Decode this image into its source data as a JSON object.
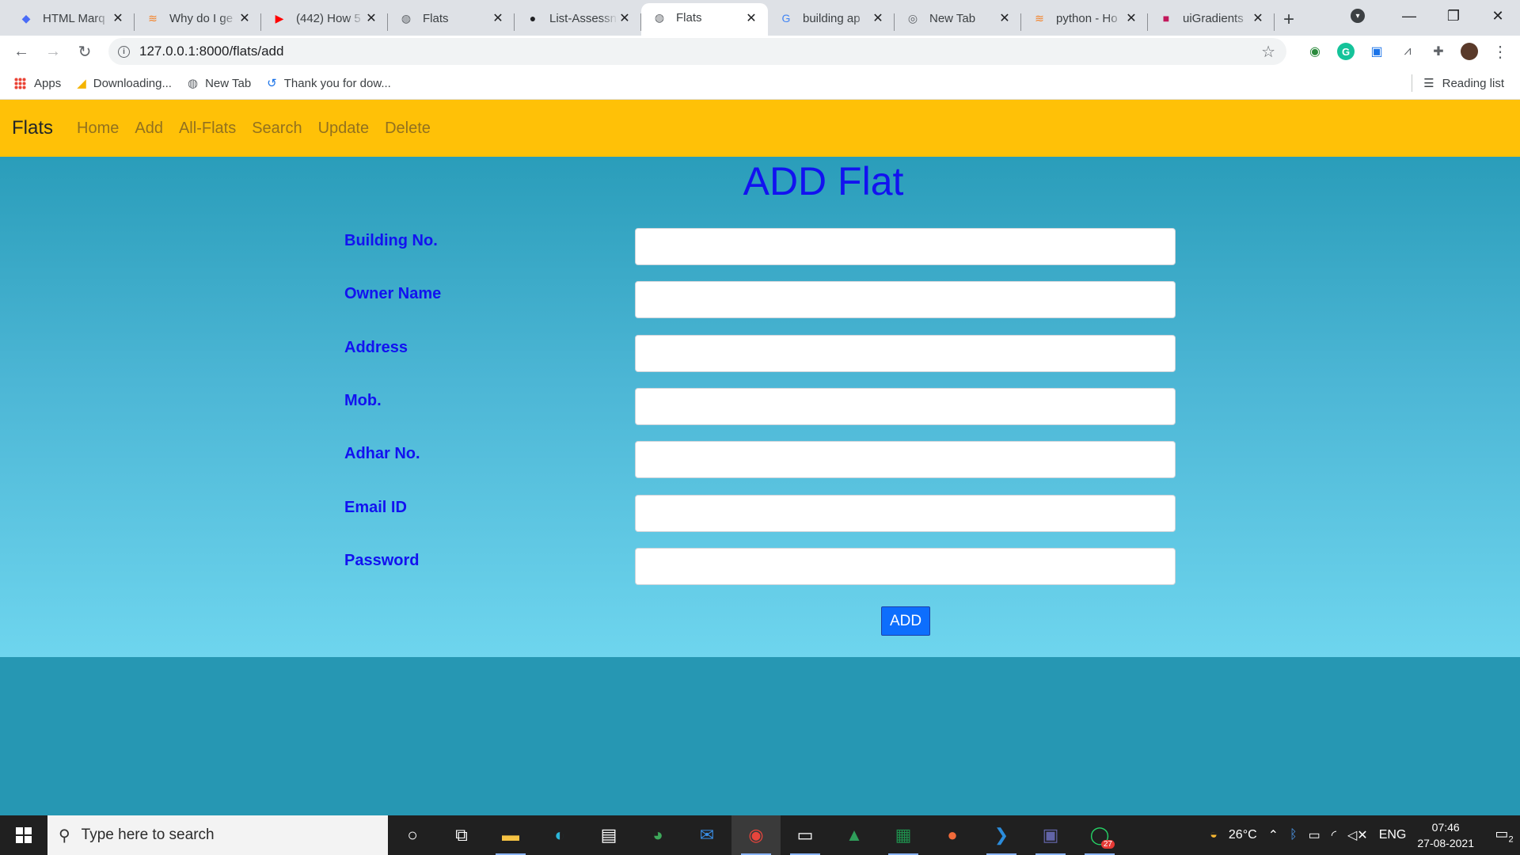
{
  "browser": {
    "tabs": [
      {
        "title": "HTML Marq",
        "icon": "codepen-icon",
        "color": "#4a6cf7",
        "glyph": "◆"
      },
      {
        "title": "Why do I ge",
        "icon": "stackoverflow-icon",
        "color": "#f48024",
        "glyph": "≋"
      },
      {
        "title": "(442) How 5",
        "icon": "youtube-icon",
        "color": "#ff0000",
        "glyph": "▶"
      },
      {
        "title": "Flats",
        "icon": "globe-icon",
        "color": "#5f6368",
        "glyph": "◍"
      },
      {
        "title": "List-Assessn",
        "icon": "github-icon",
        "color": "#202124",
        "glyph": "●"
      },
      {
        "title": "Flats",
        "icon": "globe-icon",
        "color": "#5f6368",
        "glyph": "◍",
        "active": true
      },
      {
        "title": "building ap",
        "icon": "google-icon",
        "color": "#4285f4",
        "glyph": "G"
      },
      {
        "title": "New Tab",
        "icon": "chrome-icon",
        "color": "#5f6368",
        "glyph": "◎"
      },
      {
        "title": "python - Ho",
        "icon": "stackoverflow-icon",
        "color": "#f48024",
        "glyph": "≋"
      },
      {
        "title": "uiGradients",
        "icon": "uigradients-icon",
        "color": "#c2185b",
        "glyph": "■"
      }
    ],
    "url": "127.0.0.1:8000/flats/add",
    "bookmarks": [
      {
        "label": "Apps",
        "icon": "apps-grid-icon"
      },
      {
        "label": "Downloading...",
        "icon": "download-icon"
      },
      {
        "label": "New Tab",
        "icon": "globe-icon"
      },
      {
        "label": "Thank you for dow...",
        "icon": "loader-icon"
      }
    ],
    "reading_list": "Reading list"
  },
  "navbar": {
    "brand": "Flats",
    "links": [
      "Home",
      "Add",
      "All-Flats",
      "Search",
      "Update",
      "Delete"
    ]
  },
  "form": {
    "title": "ADD Flat",
    "fields": [
      {
        "label": "Building No.",
        "value": ""
      },
      {
        "label": "Owner Name",
        "value": ""
      },
      {
        "label": "Address",
        "value": ""
      },
      {
        "label": "Mob.",
        "value": ""
      },
      {
        "label": "Adhar No.",
        "value": ""
      },
      {
        "label": "Email ID",
        "value": ""
      },
      {
        "label": "Password",
        "value": ""
      }
    ],
    "submit_label": "ADD"
  },
  "colors": {
    "navbar_bg": "#ffc107",
    "label_color": "#1212f0",
    "button_bg": "#0d6efd",
    "page_bg": "#2697b3"
  },
  "taskbar": {
    "search_placeholder": "Type here to search",
    "whatsapp_badge": "27",
    "weather": "26°C",
    "language": "ENG",
    "time": "07:46",
    "date": "27-08-2021",
    "notifications": "2"
  }
}
